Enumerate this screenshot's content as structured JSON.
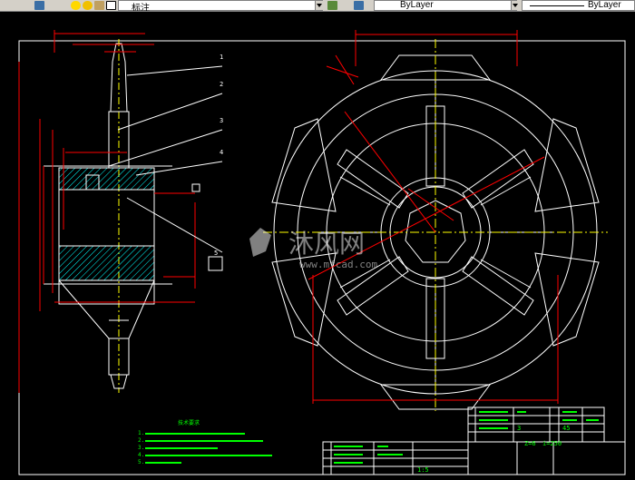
{
  "toolbar": {
    "style_value": "标注",
    "layer_color_value": "ByLayer",
    "linetype_value": "ByLayer",
    "icons": [
      "layers-icon",
      "lightbulb-icon",
      "sun-icon",
      "lock-icon",
      "color-swatch-icon",
      "layer-properties-icon",
      "linetype-icon"
    ]
  },
  "drawing": {
    "watermark_text": "沐风网",
    "watermark_url": "www.mfcad.com",
    "part_callouts": [
      "1",
      "2",
      "3",
      "4",
      "5"
    ],
    "tech_notes_title": "技术要求",
    "tech_notes": [
      "1.",
      "2.",
      "3.",
      "4.",
      "5."
    ],
    "title_block": {
      "teeth_label": "Z=6",
      "ratio_label": "i=250",
      "rows": [
        "3",
        "45"
      ],
      "scale": "1:5"
    },
    "colors": {
      "outline": "#ffffff",
      "dimension": "#ff0000",
      "center": "#ffff00",
      "hatch": "#00ffff",
      "text": "#00ff00"
    }
  }
}
